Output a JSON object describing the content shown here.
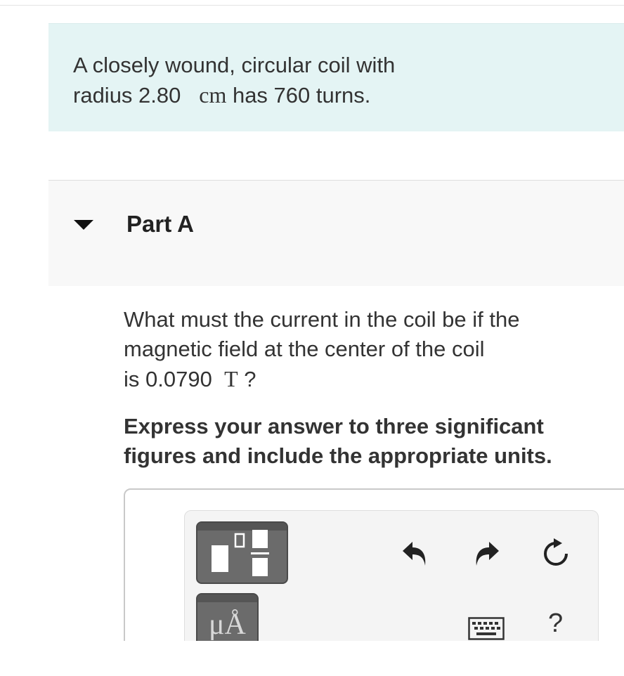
{
  "intro": {
    "line1": "A closely wound, circular coil with",
    "line2_pre": "radius 2.80",
    "line2_unit": "cm",
    "line2_post": "has 760 turns."
  },
  "part": {
    "title": "Part A"
  },
  "question": {
    "line1": "What must the current in the coil be if the",
    "line2": "magnetic field at the center of the coil",
    "line3_pre": "is 0.0790",
    "line3_unit": "T",
    "line3_post": "?"
  },
  "instruction": {
    "line1": "Express your answer to three significant",
    "line2": "figures and include the appropriate units."
  },
  "toolbar": {
    "units_label": "μÅ",
    "help_label": "?",
    "icons": [
      "templates-icon",
      "undo-icon",
      "redo-icon",
      "reset-icon",
      "keyboard-icon",
      "help-icon"
    ]
  }
}
